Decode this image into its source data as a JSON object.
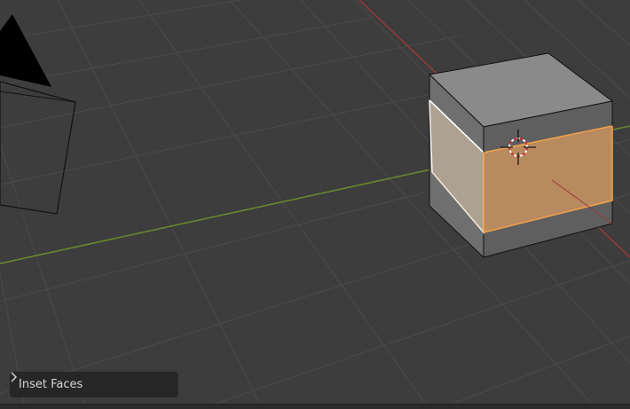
{
  "viewport": {
    "background_color": "#3d3d3d",
    "grid_color": "#4a4a4a",
    "x_axis_color": "#9a3a3a",
    "y_axis_color": "#6a8a2c",
    "selection_color": "#f4a24a"
  },
  "operator_panel": {
    "label": "Inset Faces",
    "icon": "chevron-right-icon"
  },
  "scene_objects": {
    "camera": "camera-icon",
    "mesh": "cube",
    "cursor": "3d-cursor-icon"
  }
}
